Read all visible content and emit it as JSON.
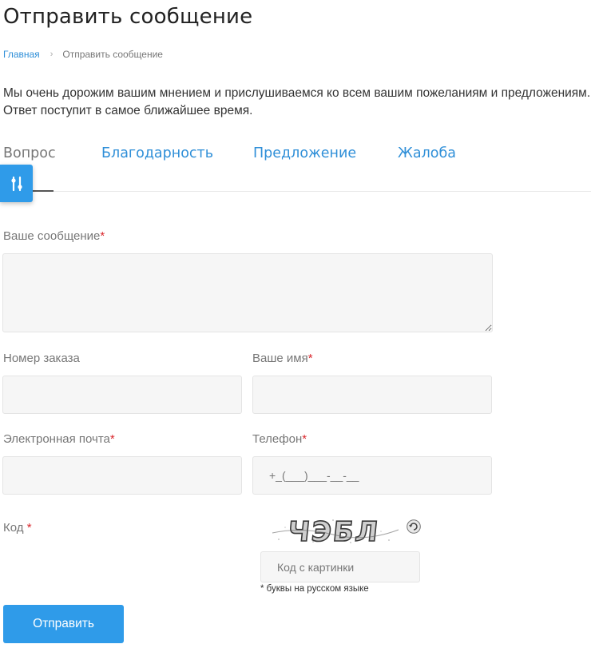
{
  "page": {
    "title": "Отправить сообщение"
  },
  "breadcrumb": {
    "home": "Главная",
    "separator": "›",
    "current": "Отправить сообщение"
  },
  "intro": {
    "line1": "Мы очень дорожим вашим мнением и прислушиваемся ко всем вашим пожеланиям и предложениям.",
    "line2": "Ответ поступит в самое ближайшее время."
  },
  "tabs": [
    {
      "label": "Вопрос",
      "active": true
    },
    {
      "label": "Благодарность",
      "active": false
    },
    {
      "label": "Предложение",
      "active": false
    },
    {
      "label": "Жалоба",
      "active": false
    }
  ],
  "float_button": {
    "icon": "sliders-icon"
  },
  "form": {
    "message": {
      "label": "Ваше сообщение",
      "required_mark": "*",
      "value": ""
    },
    "order_number": {
      "label": "Номер заказа",
      "value": ""
    },
    "name": {
      "label": "Ваше имя",
      "required_mark": "*",
      "value": ""
    },
    "email": {
      "label": "Электронная почта",
      "required_mark": "*",
      "value": ""
    },
    "phone": {
      "label": "Телефон",
      "required_mark": "*",
      "placeholder": "+_(___)___-__-__",
      "value": ""
    },
    "captcha": {
      "label": "Код",
      "required_mark": "*",
      "image_text": "ЧЭБЛ",
      "refresh_icon": "refresh-icon",
      "placeholder": "Код с картинки",
      "hint": "* буквы на русском языке"
    },
    "submit_label": "Отправить"
  },
  "colors": {
    "accent": "#2f9be9",
    "link": "#2f8fd8",
    "required": "#d9262c",
    "field_bg": "#f6f6f6"
  }
}
